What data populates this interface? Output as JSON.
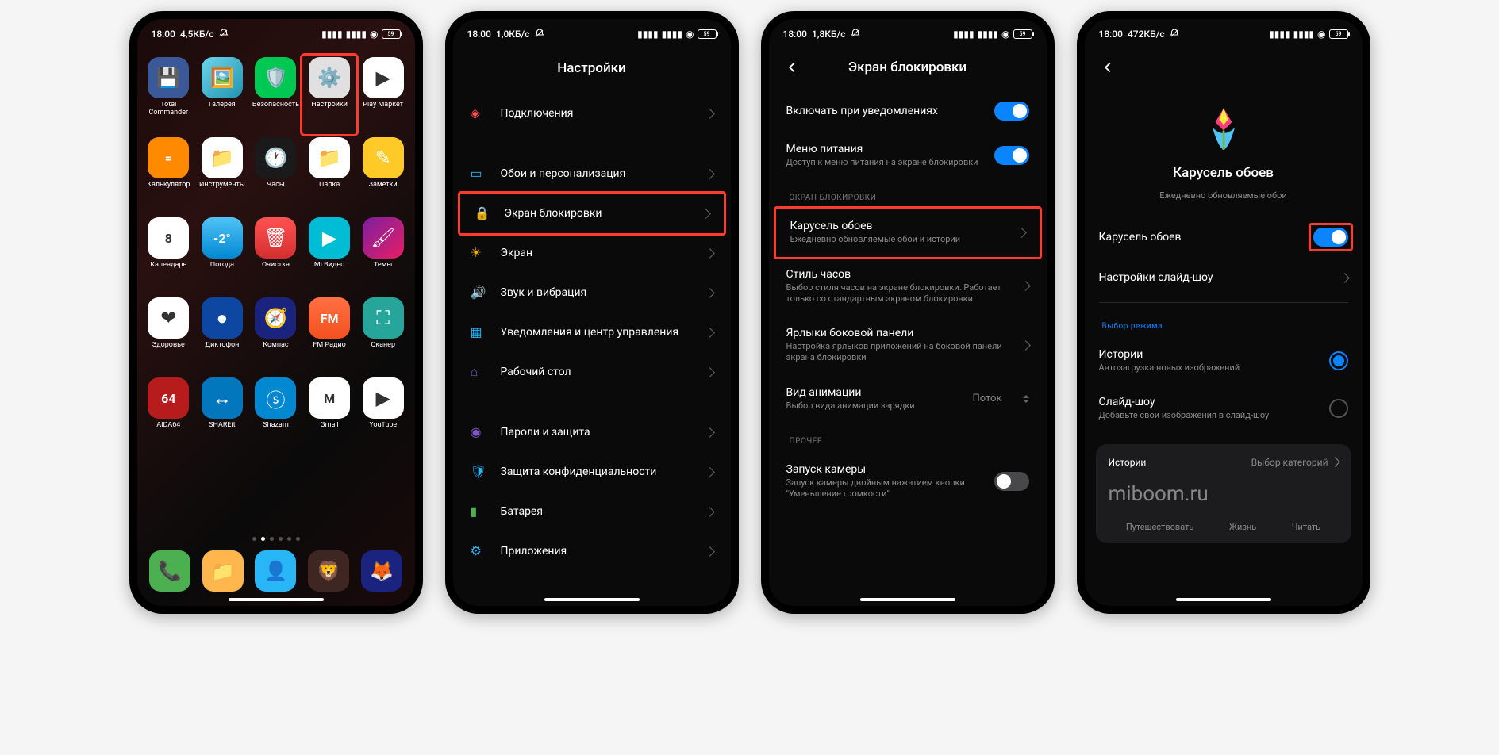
{
  "statusbar": {
    "time": "18:00",
    "speed1": "4,5КБ/с",
    "speed2": "1,0КБ/с",
    "speed3": "1,8КБ/с",
    "speed4": "472КБ/с",
    "battery": "59"
  },
  "phone1": {
    "apps": [
      {
        "label": "Total Commander",
        "bg": "#3b5998",
        "icon": "💾"
      },
      {
        "label": "Галерея",
        "bg": "linear-gradient(135deg,#6dd5ed,#2193b0)",
        "icon": "🖼️"
      },
      {
        "label": "Безопасность",
        "bg": "#00c853",
        "icon": "🛡️"
      },
      {
        "label": "Настройки",
        "bg": "#e0e0e0",
        "icon": "⚙️",
        "highlight": true
      },
      {
        "label": "Play Маркет",
        "bg": "#fff",
        "icon": "▶"
      },
      {
        "label": "Калькулятор",
        "bg": "#ff8a00",
        "icon": "="
      },
      {
        "label": "Инструменты",
        "bg": "#fff",
        "icon": "📁"
      },
      {
        "label": "Часы",
        "bg": "#1a1a1a",
        "icon": "🕐"
      },
      {
        "label": "Папка",
        "bg": "#fff",
        "icon": "📁"
      },
      {
        "label": "Заметки",
        "bg": "#ffca28",
        "icon": "✎"
      },
      {
        "label": "Календарь",
        "bg": "#fff",
        "icon": "8"
      },
      {
        "label": "Погода",
        "bg": "linear-gradient(#4fc3f7,#0288d1)",
        "icon": "-2°"
      },
      {
        "label": "Очистка",
        "bg": "linear-gradient(#ff5252,#d32f2f)",
        "icon": "🗑"
      },
      {
        "label": "Mi Видео",
        "bg": "#00bcd4",
        "icon": "▶"
      },
      {
        "label": "Темы",
        "bg": "linear-gradient(135deg,#7b1fa2,#e91e63)",
        "icon": "🖌"
      },
      {
        "label": "Здоровье",
        "bg": "#fff",
        "icon": "❤"
      },
      {
        "label": "Диктофон",
        "bg": "#0d47a1",
        "icon": "●"
      },
      {
        "label": "Компас",
        "bg": "#1a237e",
        "icon": "🧭"
      },
      {
        "label": "FM Радио",
        "bg": "linear-gradient(#ff7043,#f4511e)",
        "icon": "FM"
      },
      {
        "label": "Сканер",
        "bg": "#26a69a",
        "icon": "⛶"
      },
      {
        "label": "AIDA64",
        "bg": "#b71c1c",
        "icon": "64"
      },
      {
        "label": "SHAREit",
        "bg": "#0277bd",
        "icon": "↔"
      },
      {
        "label": "Shazam",
        "bg": "#0288d1",
        "icon": "ⓢ"
      },
      {
        "label": "Gmail",
        "bg": "#fff",
        "icon": "M"
      },
      {
        "label": "YouTube",
        "bg": "#fff",
        "icon": "▶"
      }
    ],
    "dock": [
      {
        "bg": "#4caf50",
        "icon": "📞"
      },
      {
        "bg": "#ffb74d",
        "icon": "📁"
      },
      {
        "bg": "#29b6f6",
        "icon": "👤"
      },
      {
        "bg": "#3e2723",
        "icon": "🦁"
      },
      {
        "bg": "#1a237e",
        "icon": "🦊"
      }
    ]
  },
  "phone2": {
    "title": "Настройки",
    "items": [
      {
        "label": "Подключения",
        "color": "#ff5252",
        "glyph": "◈"
      },
      {
        "spacer": true
      },
      {
        "label": "Обои и персонализация",
        "color": "#29b6f6",
        "glyph": "▭"
      },
      {
        "label": "Экран блокировки",
        "color": "#ff5252",
        "glyph": "🔒",
        "highlight": true
      },
      {
        "label": "Экран",
        "color": "#ffb300",
        "glyph": "☀"
      },
      {
        "label": "Звук и вибрация",
        "color": "#4caf50",
        "glyph": "🔊"
      },
      {
        "label": "Уведомления и центр управления",
        "color": "#29b6f6",
        "glyph": "▦"
      },
      {
        "label": "Рабочий стол",
        "color": "#7e57c2",
        "glyph": "⌂"
      },
      {
        "spacer": true
      },
      {
        "label": "Пароли и защита",
        "color": "#7e57c2",
        "glyph": "◉"
      },
      {
        "label": "Защита конфиденциальности",
        "color": "#29b6f6",
        "glyph": "🛡"
      },
      {
        "label": "Батарея",
        "color": "#4caf50",
        "glyph": "▮"
      },
      {
        "label": "Приложения",
        "color": "#29b6f6",
        "glyph": "⚙"
      }
    ]
  },
  "phone3": {
    "title": "Экран блокировки",
    "item0": {
      "label": "Включать при уведомлениях"
    },
    "item1": {
      "label": "Меню питания",
      "sub": "Доступ к меню питания на экране блокировки"
    },
    "section1": "ЭКРАН БЛОКИРОВКИ",
    "item2": {
      "label": "Карусель обоев",
      "sub": "Ежедневно обновляемые обои и истории",
      "highlight": true
    },
    "item3": {
      "label": "Стиль часов",
      "sub": "Выбор стиля часов на экране блокировки. Работает только со стандартным экраном блокировки"
    },
    "item4": {
      "label": "Ярлыки боковой панели",
      "sub": "Настройка ярлыков приложений на боковой панели экрана блокировки"
    },
    "item5": {
      "label": "Вид анимации",
      "sub": "Выбор вида анимации зарядки",
      "value": "Поток"
    },
    "section2": "ПРОЧЕЕ",
    "item6": {
      "label": "Запуск камеры",
      "sub": "Запуск камеры двойным нажатием кнопки \"Уменьшение громкости\""
    }
  },
  "phone4": {
    "hero_title": "Карусель обоев",
    "hero_sub": "Ежедневно обновляемые обои",
    "toggle_label": "Карусель обоев",
    "slideshow_settings": "Настройки слайд-шоу",
    "mode_section": "Выбор режима",
    "mode1": {
      "label": "Истории",
      "sub": "Автозагрузка новых изображений"
    },
    "mode2": {
      "label": "Слайд-шоу",
      "sub": "Добавьте свои изображения в слайд-шоу"
    },
    "card": {
      "left": "Истории",
      "right": "Выбор категорий",
      "big": "miboom.ru",
      "tabs": [
        "Путешествовать",
        "Жизнь",
        "Читать"
      ]
    }
  }
}
